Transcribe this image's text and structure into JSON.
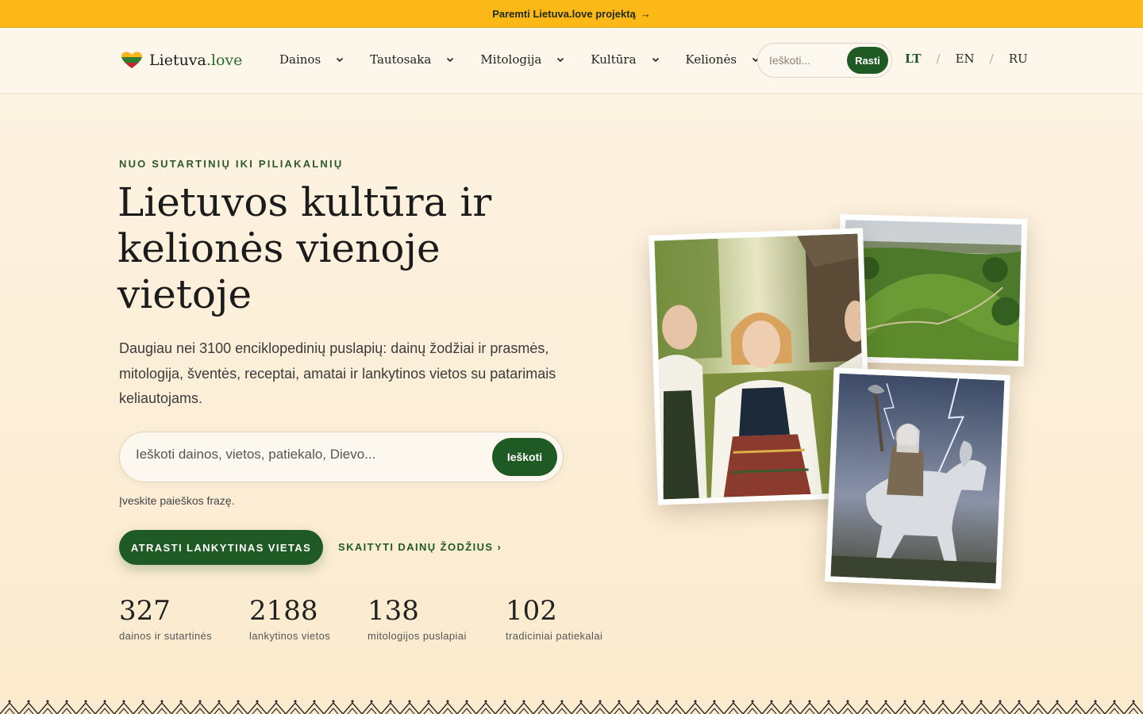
{
  "banner": {
    "text": "Paremti Lietuva.love projektą",
    "arrow": "→"
  },
  "header": {
    "brand_name": "Lietuva",
    "brand_tld": ".love",
    "nav": [
      {
        "label": "Dainos"
      },
      {
        "label": "Tautosaka"
      },
      {
        "label": "Mitologija"
      },
      {
        "label": "Kultūra"
      },
      {
        "label": "Kelionės"
      }
    ],
    "search_placeholder": "Ieškoti...",
    "search_button": "Rasti",
    "languages": [
      "LT",
      "EN",
      "RU"
    ],
    "active_language": "LT"
  },
  "hero": {
    "eyebrow": "NUO SUTARTINIŲ IKI PILIAKALNIŲ",
    "title": "Lietuvos kultūra ir kelionės vienoje vietoje",
    "lead": "Daugiau nei 3100 enciklopedinių puslapių: dainų žodžiai ir prasmės, mitologija, šventės, receptai, amatai ir lankytinos vietos su patarimais keliautojams.",
    "search_placeholder": "Ieškoti dainos, vietos, patiekalo, Dievo...",
    "search_button": "Ieškoti",
    "hint": "Įveskite paieškos frazę.",
    "cta_primary": "ATRASTI LANKYTINAS VIETAS",
    "cta_secondary": "SKAITYTI DAINŲ ŽODŽIUS ›",
    "stats": [
      {
        "value": "327",
        "label": "dainos ir sutartinės"
      },
      {
        "value": "2188",
        "label": "lankytinos vietos"
      },
      {
        "value": "138",
        "label": "mitologijos puslapiai"
      },
      {
        "value": "102",
        "label": "tradiciniai patiekalai"
      }
    ]
  },
  "colors": {
    "banner": "#fbb817",
    "accent_green": "#1f5a25",
    "background": "#fdf3e2"
  }
}
